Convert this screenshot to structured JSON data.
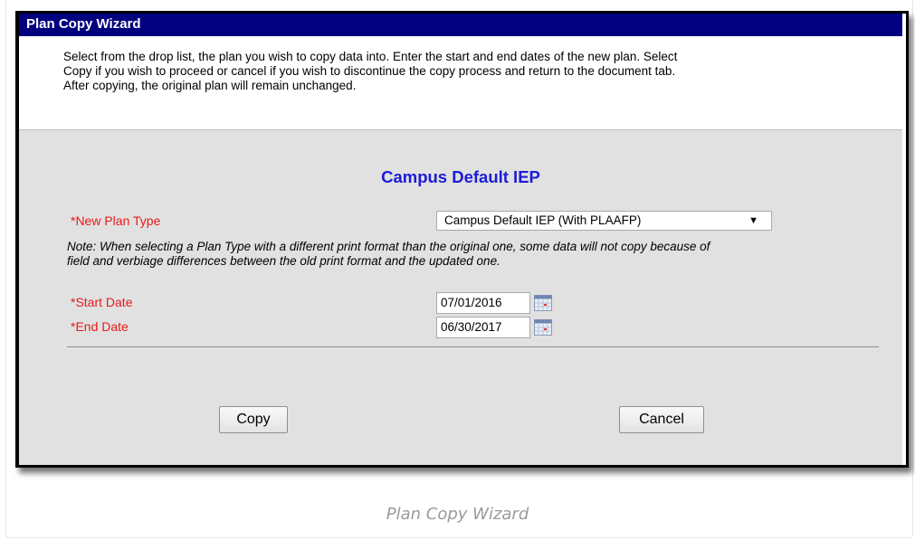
{
  "window": {
    "title": "Plan Copy Wizard"
  },
  "intro": {
    "line1": "Select from the drop list, the plan you wish to copy data into. Enter the start and end dates of the new plan. Select",
    "line2": "Copy if you wish to proceed or cancel if you wish to discontinue the copy process and return to the document tab.",
    "line3": "After copying, the original plan will remain unchanged."
  },
  "form": {
    "heading": "Campus Default IEP",
    "plan_type_label": "*New Plan Type",
    "plan_type_value": "Campus Default IEP (With PLAAFP)",
    "note_line1": "Note: When selecting a Plan Type with a different print format than the original one, some data will not copy because of",
    "note_line2": "field and verbiage differences between the old print format and the updated one.",
    "start_date_label": "*Start Date",
    "start_date_value": "07/01/2016",
    "end_date_label": "*End Date",
    "end_date_value": "06/30/2017",
    "calendar_icon": "calendar-icon"
  },
  "buttons": {
    "copy": "Copy",
    "cancel": "Cancel"
  },
  "caption": "Plan Copy Wizard",
  "colors": {
    "titlebar": "#01017f",
    "heading": "#1c1cd6",
    "required_label": "#e51a1a",
    "panel": "#e1e1e1"
  }
}
